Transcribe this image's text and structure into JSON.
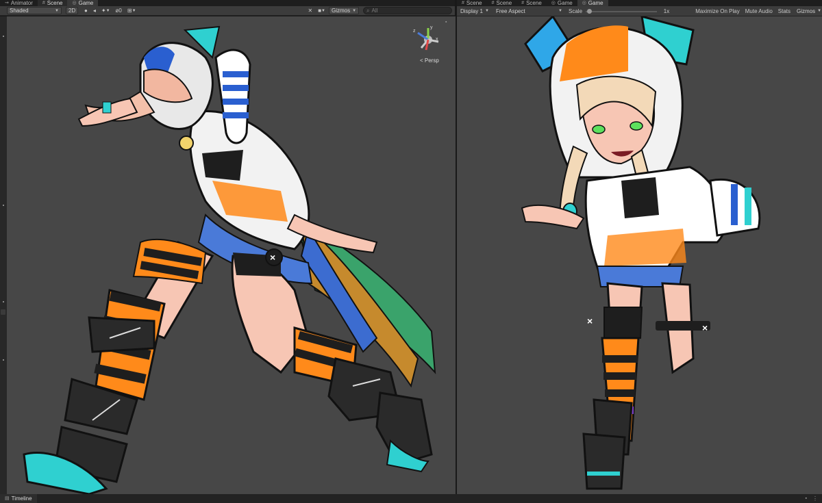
{
  "left_panel": {
    "tabs": [
      {
        "icon": "animator-icon",
        "label": "Animator"
      },
      {
        "icon": "scene-icon",
        "label": "Scene"
      },
      {
        "icon": "game-icon",
        "label": "Game"
      }
    ],
    "toolbar": {
      "draw_mode": "Shaded",
      "mode_2d": "2D",
      "hidden_count": "0",
      "gizmos_label": "Gizmos",
      "search_placeholder": "All"
    },
    "orientation_gizmo": {
      "x_axis": "x",
      "y_axis": "y",
      "z_axis": "z",
      "projection_label": "< Persp"
    }
  },
  "right_panel": {
    "tabs": [
      {
        "icon": "scene-icon",
        "label": "Scene"
      },
      {
        "icon": "scene-icon",
        "label": "Scene"
      },
      {
        "icon": "scene-icon",
        "label": "Scene"
      },
      {
        "icon": "game-icon",
        "label": "Game"
      },
      {
        "icon": "game-icon",
        "label": "Game"
      }
    ],
    "toolbar": {
      "display": "Display 1",
      "aspect": "Free Aspect",
      "scale_label": "Scale",
      "scale_value": "1x",
      "scale_fraction": 0.02,
      "maximize_on_play": "Maximize On Play",
      "mute_audio": "Mute Audio",
      "stats": "Stats",
      "gizmos": "Gizmos"
    }
  },
  "bottom_panel": {
    "tab_label": "Timeline"
  },
  "colors": {
    "editor_bg": "#191919",
    "toolbar_bg": "#3c3c3c",
    "viewport_bg": "#474747",
    "active_tab_bg": "#383838",
    "character_orange": "#ff8a1a",
    "character_cyan": "#2fd0d0",
    "character_black": "#1e1e1e"
  }
}
